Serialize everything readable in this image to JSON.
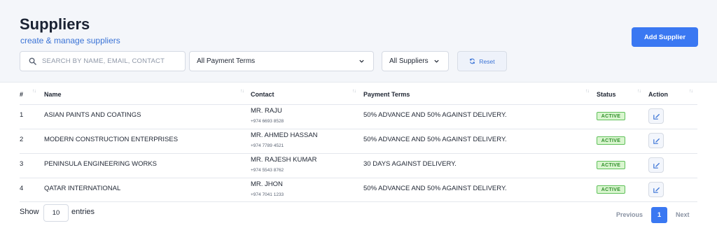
{
  "page": {
    "title": "Suppliers",
    "subtitle": "create & manage suppliers",
    "add_button": "Add Supplier"
  },
  "filters": {
    "search_placeholder": "SEARCH BY NAME, EMAIL, CONTACT",
    "payment_terms_value": "All Payment Terms",
    "suppliers_value": "All Suppliers",
    "reset_label": "Reset"
  },
  "table": {
    "columns": [
      "#",
      "Name",
      "Contact",
      "Payment Terms",
      "Status",
      "Action"
    ],
    "rows": [
      {
        "idx": "1",
        "name": "ASIAN PAINTS AND COATINGS",
        "contact_name": "MR. RAJU",
        "contact_phone": "+974 6693 8528",
        "terms": "50% ADVANCE AND 50% AGAINST DELIVERY.",
        "status": "ACTIVE"
      },
      {
        "idx": "2",
        "name": "MODERN CONSTRUCTION ENTERPRISES",
        "contact_name": "MR. AHMED HASSAN",
        "contact_phone": "+974 7789 4521",
        "terms": "50% ADVANCE AND 50% AGAINST DELIVERY.",
        "status": "ACTIVE"
      },
      {
        "idx": "3",
        "name": "PENINSULA ENGINEERING WORKS",
        "contact_name": "MR. RAJESH KUMAR",
        "contact_phone": "+974 5543 8762",
        "terms": "30 DAYS AGAINST DELIVERY.",
        "status": "ACTIVE"
      },
      {
        "idx": "4",
        "name": "QATAR INTERNATIONAL",
        "contact_name": "MR. JHON",
        "contact_phone": "+974 7041 1233",
        "terms": "50% ADVANCE AND 50% AGAINST DELIVERY.",
        "status": "ACTIVE"
      }
    ]
  },
  "footer": {
    "show_label": "Show",
    "entries_value": "10",
    "entries_label": "entries",
    "prev_label": "Previous",
    "current_page": "1",
    "next_label": "Next"
  },
  "colors": {
    "accent": "#3a78f2",
    "status_active_bg": "#d9f5cf",
    "status_active_text": "#2f8f2a"
  },
  "icons": {
    "search": "search-icon",
    "chevron": "chevron-down-icon",
    "reset": "refresh-icon",
    "edit": "edit-icon",
    "sort": "sort-icon"
  }
}
